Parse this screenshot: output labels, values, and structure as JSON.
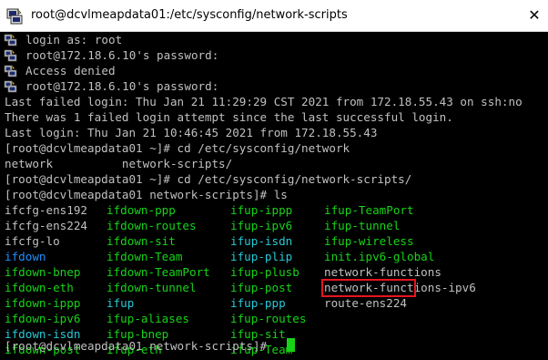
{
  "window": {
    "title": "root@dcvlmeapdata01:/etc/sysconfig/network-scripts",
    "close_glyph": "✕"
  },
  "terminal": {
    "login_lines": [
      "login as: root",
      "root@172.18.6.10's password:",
      "Access denied",
      "root@172.18.6.10's password:"
    ],
    "lines": [
      "Last failed login: Thu Jan 21 11:29:29 CST 2021 from 172.18.55.43 on ssh:no",
      "There was 1 failed login attempt since the last successful login.",
      "Last login: Thu Jan 21 10:46:45 2021 from 172.18.55.43",
      "[root@dcvlmeapdata01 ~]# cd /etc/sysconfig/network",
      "network          network-scripts/",
      "[root@dcvlmeapdata01 ~]# cd /etc/sysconfig/network-scripts/",
      "[root@dcvlmeapdata01 network-scripts]# ls"
    ],
    "ls_rows": [
      [
        "ifcfg-ens192",
        "ifdown-ppp",
        "ifup-ippp",
        "ifup-TeamPort"
      ],
      [
        "ifcfg-ens224",
        "ifdown-routes",
        "ifup-ipv6",
        "ifup-tunnel"
      ],
      [
        "ifcfg-lo",
        "ifdown-sit",
        "ifup-isdn",
        "ifup-wireless"
      ],
      [
        "ifdown",
        "ifdown-Team",
        "ifup-plip",
        "init.ipv6-global"
      ],
      [
        "ifdown-bnep",
        "ifdown-TeamPort",
        "ifup-plusb",
        "network-functions"
      ],
      [
        "ifdown-eth",
        "ifdown-tunnel",
        "ifup-post",
        "network-functions-ipv6"
      ],
      [
        "ifdown-ippp",
        "ifup",
        "ifup-ppp",
        "route-ens224"
      ],
      [
        "ifdown-ipv6",
        "ifup-aliases",
        "ifup-routes",
        ""
      ],
      [
        "ifdown-isdn",
        "ifup-bnep",
        "ifup-sit",
        ""
      ],
      [
        "ifdown-post",
        "ifup-eth",
        "ifup-Team",
        ""
      ]
    ],
    "prompt": "[root@dcvlmeapdata01 network-scripts]# ",
    "colors": {
      "background": "#000000",
      "default_text": "#c0c0c0",
      "executable": "#17d317",
      "directory": "#1e90ff",
      "symlink": "#27c9d6",
      "highlight_box": "#e8141e"
    }
  }
}
